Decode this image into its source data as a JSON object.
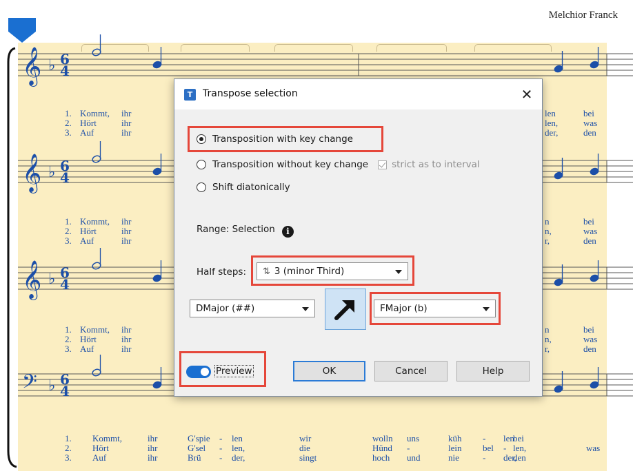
{
  "score": {
    "composer": "Melchior Franck",
    "staff_clefs": [
      "treble-clef",
      "treble-clef",
      "treble-8vb-clef",
      "bass-clef"
    ],
    "key_signature": "b",
    "time_signature": "6/4",
    "lyric_blocks": [
      {
        "rows": [
          {
            "num": "1.",
            "words": [
              "Kommt,",
              "ihr"
            ],
            "right": [
              "len",
              "bei"
            ]
          },
          {
            "num": "2.",
            "words": [
              "Hört",
              "ihr"
            ],
            "right": [
              "len,",
              "was"
            ]
          },
          {
            "num": "3.",
            "words": [
              "Auf",
              "ihr"
            ],
            "right": [
              "der,",
              "den"
            ]
          }
        ]
      },
      {
        "rows": [
          {
            "num": "1.",
            "words": [
              "Kommt,",
              "ihr"
            ],
            "right": [
              "n",
              "bei"
            ]
          },
          {
            "num": "2.",
            "words": [
              "Hört",
              "ihr"
            ],
            "right": [
              "n,",
              "was"
            ]
          },
          {
            "num": "3.",
            "words": [
              "Auf",
              "ihr"
            ],
            "right": [
              "r,",
              "den"
            ]
          }
        ]
      },
      {
        "rows": [
          {
            "num": "1.",
            "words": [
              "Kommt,",
              "ihr"
            ],
            "right": [
              "n",
              "bei"
            ]
          },
          {
            "num": "2.",
            "words": [
              "Hört",
              "ihr"
            ],
            "right": [
              "n,",
              "was"
            ]
          },
          {
            "num": "3.",
            "words": [
              "Auf",
              "ihr"
            ],
            "right": [
              "r,",
              "den"
            ]
          }
        ]
      }
    ],
    "bottom_lyrics": [
      {
        "num": "1.",
        "words": [
          "Kommt,",
          "ihr",
          "G'spie",
          "-",
          "len",
          "wir",
          "wolln",
          "uns",
          "küh",
          "-",
          "len",
          "bei"
        ]
      },
      {
        "num": "2.",
        "words": [
          "Hört",
          "ihr",
          "G'sel",
          "-",
          "len,",
          "die",
          "Hünd",
          "-",
          "lein",
          "bel",
          "-",
          "len,",
          "was"
        ]
      },
      {
        "num": "3.",
        "words": [
          "Auf",
          "ihr",
          "Brü",
          "-",
          "der,",
          "singt",
          "hoch",
          "und",
          "nie",
          "-",
          "der,",
          "den"
        ]
      }
    ]
  },
  "dialog": {
    "title": "Transpose selection",
    "app_icon_glyph": "T",
    "close_glyph": "✕",
    "options": {
      "with_key_change": "Transposition with key change",
      "without_key_change": "Transposition without key change",
      "strict_interval": "strict as to interval",
      "shift_diatonically": "Shift diatonically",
      "selected": "with_key_change"
    },
    "range_label": "Range: Selection",
    "info_glyph": "i",
    "half_steps_label": "Half steps:",
    "half_steps_value": "3 (minor Third)",
    "half_steps_icon": "⇅",
    "from_key": "DMajor (##)",
    "to_key": "FMajor (b)",
    "direction_icon": "arrow-up-right-icon",
    "preview_label": "Preview",
    "preview_enabled": true,
    "buttons": {
      "ok": "OK",
      "cancel": "Cancel",
      "help": "Help"
    },
    "highlight_color": "#e5473a",
    "accent_color": "#1a6fd1"
  }
}
